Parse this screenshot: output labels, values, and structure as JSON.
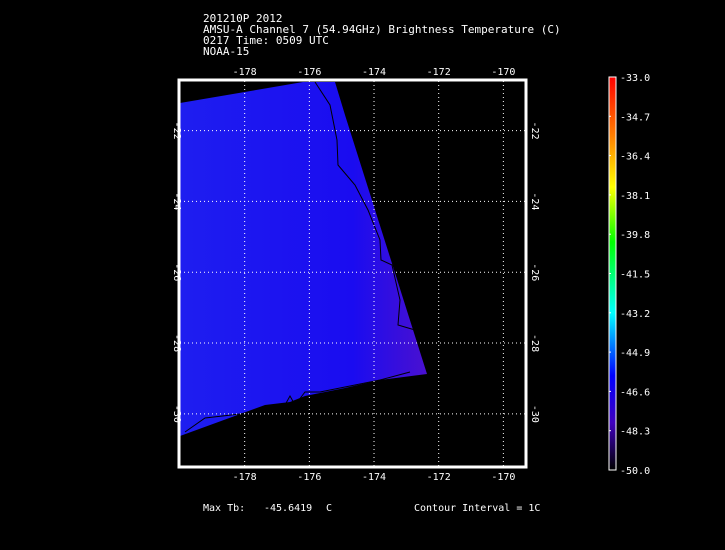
{
  "header": {
    "line1": "201210P 2012",
    "line2": "AMSU-A Channel 7 (54.94GHz) Brightness Temperature (C)",
    "line3": "0217 Time: 0509 UTC",
    "line4": "NOAA-15"
  },
  "footer": {
    "max_label": "Max Tb:",
    "max_value": "-45.6419",
    "max_unit": "C",
    "contour": "Contour Interval = 1C"
  },
  "chart_data": {
    "type": "heatmap",
    "title": "AMSU-A Channel 7 (54.94GHz) Brightness Temperature (C)",
    "xlim": [
      -180,
      -169.3
    ],
    "ylim": [
      -31.5,
      -20.6
    ],
    "x_ticks": [
      -178,
      -176,
      -174,
      -172,
      -170
    ],
    "y_ticks": [
      -22,
      -24,
      -26,
      -28,
      -30
    ],
    "x_tick_labels": [
      "-178",
      "-176",
      "-174",
      "-172",
      "-170"
    ],
    "y_tick_labels": [
      "-22",
      "-24",
      "-26",
      "-28",
      "-30"
    ],
    "grid": true,
    "colorbar": {
      "min": -50.0,
      "max": -33.0,
      "tick_labels": [
        "-33.0",
        "-34.7",
        "-36.4",
        "-38.1",
        "-39.8",
        "-41.5",
        "-43.2",
        "-44.9",
        "-46.6",
        "-48.3",
        "-50.0"
      ],
      "colors": [
        "#ff0000",
        "#ff8000",
        "#ffff00",
        "#00ff00",
        "#00ffff",
        "#0000ff",
        "#4000c0",
        "#000000"
      ]
    },
    "swath_value_range": [
      -47.0,
      -45.6419
    ],
    "swath_color": "#1a14f0",
    "swath_edge_color": "#4a10d0"
  }
}
